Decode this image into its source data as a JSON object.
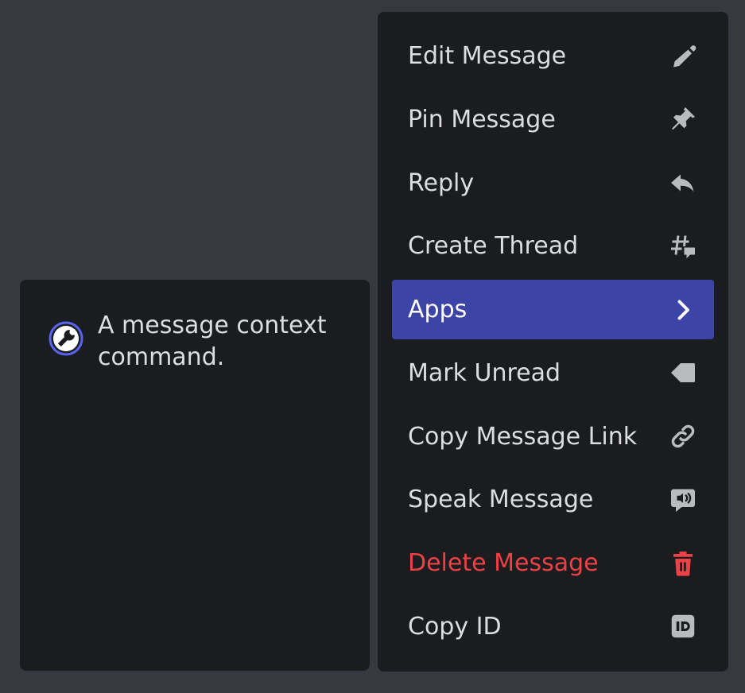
{
  "context_menu": {
    "items": [
      {
        "label": "Edit Message",
        "icon": "pencil-icon"
      },
      {
        "label": "Pin Message",
        "icon": "pin-icon"
      },
      {
        "label": "Reply",
        "icon": "reply-icon"
      },
      {
        "label": "Create Thread",
        "icon": "thread-icon"
      },
      {
        "label": "Apps",
        "icon": "chevron-right-icon"
      },
      {
        "label": "Mark Unread",
        "icon": "mark-unread-icon"
      },
      {
        "label": "Copy Message Link",
        "icon": "link-icon"
      },
      {
        "label": "Speak Message",
        "icon": "speak-icon"
      },
      {
        "label": "Delete Message",
        "icon": "trash-icon"
      },
      {
        "label": "Copy ID",
        "icon": "id-icon"
      }
    ],
    "active_item": "Apps"
  },
  "apps_submenu": {
    "items": [
      {
        "label": "A message context command.",
        "icon": "app-avatar-icon"
      }
    ]
  },
  "colors": {
    "background": "#36393f",
    "menu_background": "#1b1c20",
    "active_background": "#3d44a7",
    "danger": "#ed4245",
    "text": "#dcddde",
    "icon": "#b9bbbe"
  }
}
